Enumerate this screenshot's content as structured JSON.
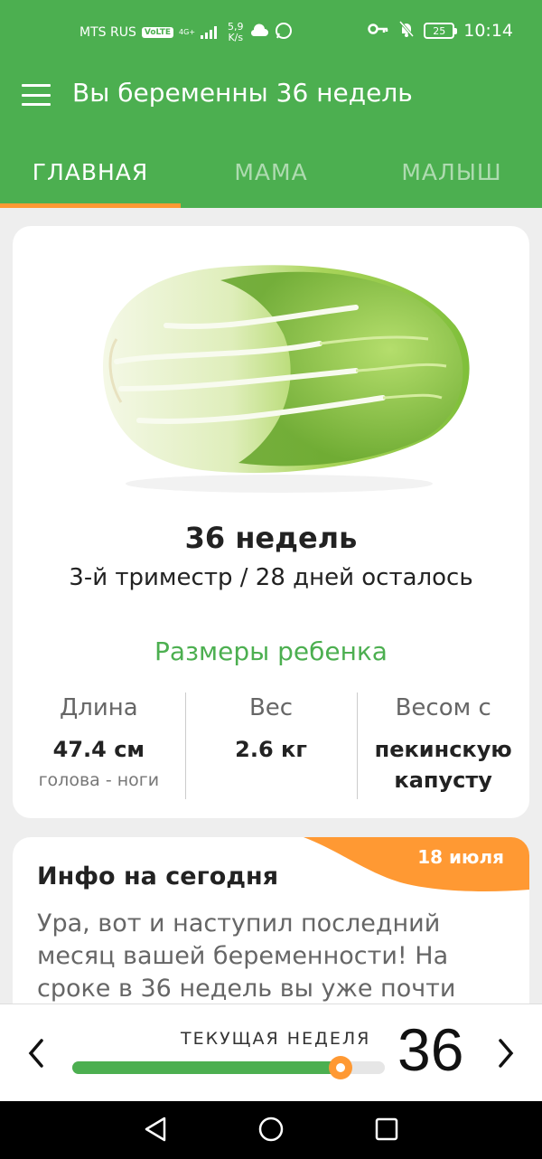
{
  "status_bar": {
    "carrier": "MTS RUS",
    "volte": "VoLTE",
    "network": "4G+",
    "speed_value": "5,9",
    "speed_unit": "K/s",
    "battery": "25",
    "time": "10:14"
  },
  "app_bar": {
    "title": "Вы беременны 36 недель"
  },
  "tabs": [
    {
      "label": "ГЛАВНАЯ",
      "active": true
    },
    {
      "label": "МАМА",
      "active": false
    },
    {
      "label": "МАЛЫШ",
      "active": false
    }
  ],
  "week_card": {
    "title": "36 недель",
    "subtitle": "3-й триместр / 28 дней осталось",
    "sizes_title": "Размеры ребенка",
    "stats": [
      {
        "label": "Длина",
        "value": "47.4 см",
        "sub": "голова - ноги"
      },
      {
        "label": "Вес",
        "value": "2.6 кг",
        "sub": ""
      },
      {
        "label": "Весом с",
        "value": "пекинскую капусту",
        "sub": ""
      }
    ]
  },
  "info_card": {
    "date": "18 июля",
    "title": "Инфо на сегодня",
    "text": "Ура, вот и наступил последний месяц вашей беременности! На сроке в 36 недель вы уже почти"
  },
  "week_bar": {
    "label": "ТЕКУЩАЯ НЕДЕЛЯ",
    "week": "36",
    "progress_fraction": 0.857
  },
  "colors": {
    "primary": "#4caf50",
    "accent": "#ff9933"
  },
  "icons": {
    "menu": "hamburger-menu-icon",
    "prev": "chevron-left-icon",
    "next": "chevron-right-icon"
  }
}
